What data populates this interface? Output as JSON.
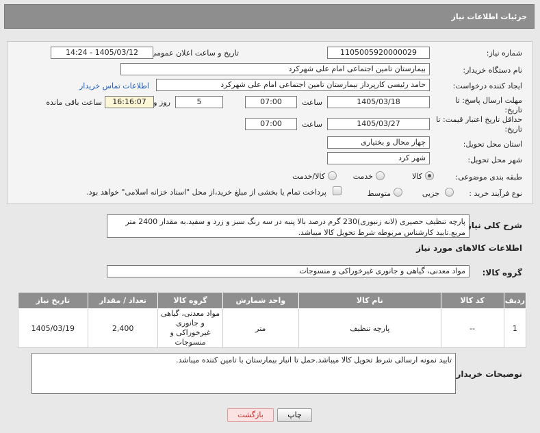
{
  "page": {
    "title": "جزئیات اطلاعات نیاز"
  },
  "form": {
    "need_number_label": "شماره نیاز:",
    "need_number": "1105005920000029",
    "announce_label": "تاریخ و ساعت اعلان عمومی:",
    "announce_value": "1405/03/12 - 14:24",
    "buyer_label": "نام دستگاه خریدار:",
    "buyer_value": "بیمارستان تامین اجتماعی امام علی شهرکرد",
    "creator_label": "ایجاد کننده درخواست:",
    "creator_value": "حامد رئیسی کارپرداز بیمارستان تامین اجتماعی امام علی شهرکرد",
    "contact_link": "اطلاعات تماس خریدار",
    "deadline_label": "مهلت ارسال پاسخ: تا تاریخ:",
    "deadline_date": "1405/03/18",
    "time_label": "ساعت",
    "deadline_time": "07:00",
    "days_value": "5",
    "days_label": "روز و",
    "remaining_time": "16:16:07",
    "remaining_label": "ساعت باقی مانده",
    "validity_label": "حداقل تاریخ اعتبار قیمت: تا تاریخ:",
    "validity_date": "1405/03/27",
    "validity_time": "07:00",
    "province_label": "استان محل تحویل:",
    "province_value": "چهار محال و بختیاری",
    "city_label": "شهر محل تحویل:",
    "city_value": "شهر کرد",
    "category_label": "طبقه بندی موضوعی:",
    "category_options": [
      "کالا",
      "خدمت",
      "کالا/خدمت"
    ],
    "process_label": "نوع فرآیند خرید :",
    "process_options": [
      "جزیی",
      "متوسط"
    ],
    "payment_note": "پرداخت تمام یا بخشی از مبلغ خرید،از محل \"اسناد خزانه اسلامی\" خواهد بود."
  },
  "summary": {
    "label": "شرح کلی نیاز:",
    "text": "پارچه تنظیف حصیری (لانه زنبوری)230 گرم درصد بالا پنبه در سه رنگ سبز و زرد و سفید.به مقدار 2400 متر مربع.تایید کارشناس مربوطه شرط تحویل کالا میباشد."
  },
  "goods": {
    "section_title": "اطلاعات کالاهای مورد نیاز",
    "group_label": "گروه کالا:",
    "group_value": "مواد معدنی، گیاهی و جانوری غیرخوراکی و منسوجات",
    "columns": [
      "ردیف",
      "کد کالا",
      "نام کالا",
      "واحد شمارش",
      "گروه کالا",
      "تعداد / مقدار",
      "تاریخ نیاز"
    ],
    "rows": [
      {
        "row": "1",
        "code": "--",
        "name": "پارچه تنظیف",
        "unit": "متر",
        "group": "مواد معدنی، گیاهی و جانوری غیرخوراکی و منسوجات",
        "qty": "2,400",
        "date": "1405/03/19"
      }
    ]
  },
  "buyer_notes": {
    "label": "توضیحات خریدار:",
    "text": "تایید نمونه ارسالی شرط تحویل کالا میباشد.حمل تا انبار بیمارستان با تامین کننده میباشد."
  },
  "buttons": {
    "print": "چاپ",
    "back": "بازگشت"
  }
}
